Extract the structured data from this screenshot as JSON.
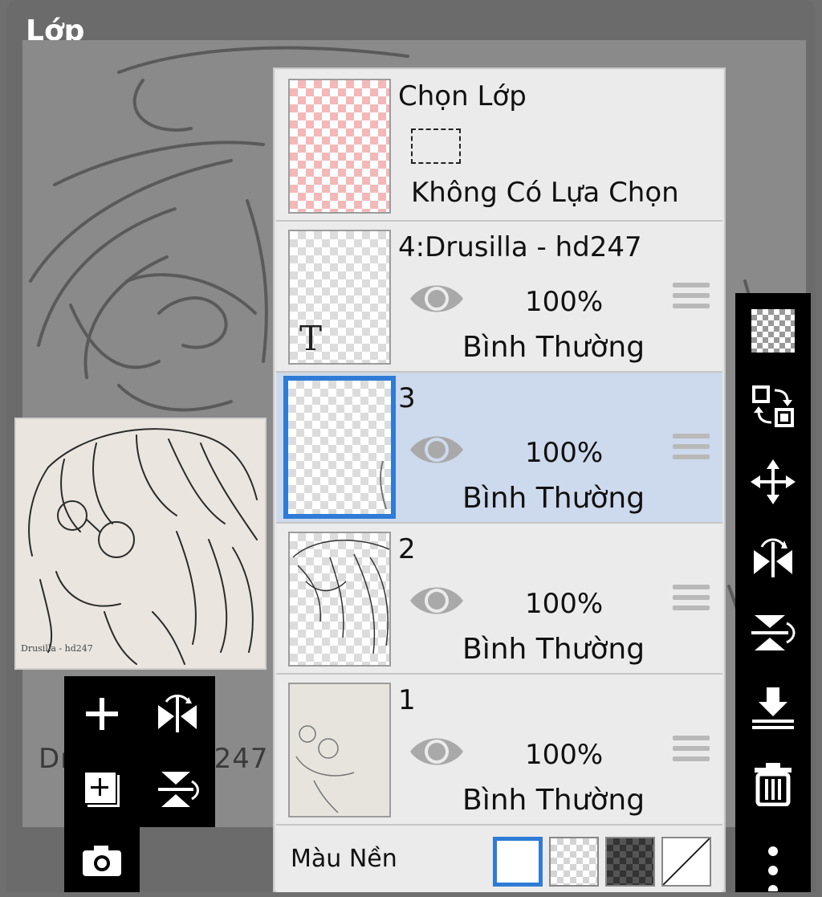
{
  "title": "Lớp",
  "canvas": {
    "signature_text": "Drusilla - hd247"
  },
  "preview": {
    "signature_text": "Drusilla - hd247"
  },
  "selection_row": {
    "title": "Chọn Lớp",
    "status": "Không Có Lựa Chọn"
  },
  "layers": [
    {
      "name": "4:Drusilla - hd247",
      "opacity": "100%",
      "blend": "Bình Thường",
      "visible": true,
      "selected": false,
      "type": "text"
    },
    {
      "name": "3",
      "opacity": "100%",
      "blend": "Bình Thường",
      "visible": true,
      "selected": true,
      "type": "raster"
    },
    {
      "name": "2",
      "opacity": "100%",
      "blend": "Bình Thường",
      "visible": true,
      "selected": false,
      "type": "raster"
    },
    {
      "name": "1",
      "opacity": "100%",
      "blend": "Bình Thường",
      "visible": true,
      "selected": false,
      "type": "raster"
    }
  ],
  "background": {
    "label": "Màu Nền",
    "options": [
      "white",
      "checker-light",
      "checker-dark",
      "none"
    ],
    "selected": "white"
  },
  "left_toolbar": [
    "add-layer-icon",
    "flip-horizontal-icon",
    "duplicate-layer-icon",
    "flip-vertical-icon",
    "camera-icon"
  ],
  "right_toolbar": [
    "transparency-icon",
    "swap-icon",
    "move-icon",
    "flip-horizontal-icon",
    "flip-vertical-icon",
    "merge-down-icon",
    "delete-icon",
    "more-icon"
  ],
  "colors": {
    "selection": "#2f7bd6",
    "selected_row": "#cdd9ec",
    "panel": "#ebebeb",
    "toolbar": "#000000"
  }
}
